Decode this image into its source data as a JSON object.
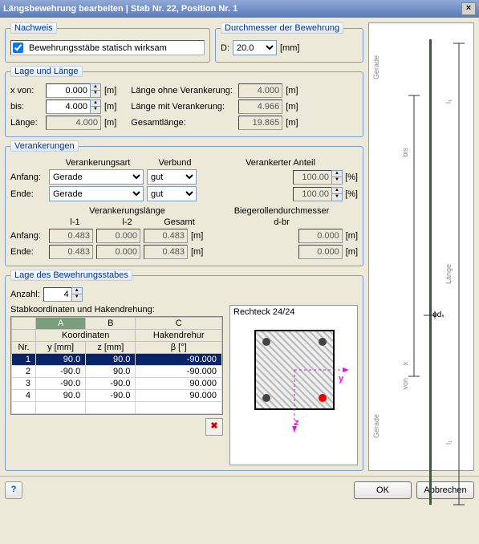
{
  "title": "Längsbewehrung bearbeiten  |  Stab Nr. 22, Position Nr. 1",
  "nachweis": {
    "legend": "Nachweis",
    "checkbox": "Bewehrungsstäbe statisch wirksam"
  },
  "diameter": {
    "legend": "Durchmesser der Bewehrung",
    "d_label": "D:",
    "d_value": "20.0",
    "d_unit": "[mm]"
  },
  "lage": {
    "legend": "Lage und Länge",
    "xvon": "x von:",
    "xvon_v": "0.000",
    "xvon_u": "[m]",
    "bis": "bis:",
    "bis_v": "4.000",
    "bis_u": "[m]",
    "laenge": "Länge:",
    "laenge_v": "4.000",
    "laenge_u": "[m]",
    "lov": "Länge ohne Verankerung:",
    "lov_v": "4.000",
    "lov_u": "[m]",
    "lmv": "Länge mit Verankerung:",
    "lmv_v": "4.966",
    "lmv_u": "[m]",
    "ges": "Gesamtlänge:",
    "ges_v": "19.865",
    "ges_u": "[m]"
  },
  "verank": {
    "legend": "Verankerungen",
    "h_art": "Verankerungsart",
    "h_verb": "Verbund",
    "h_ant": "Verankerter Anteil",
    "anfang": "Anfang:",
    "ende": "Ende:",
    "art1": "Gerade",
    "art2": "Gerade",
    "verb1": "gut",
    "verb2": "gut",
    "ant1": "100.00",
    "ant2": "100.00",
    "pct": "[%]",
    "h_vl": "Verankerungslänge",
    "h_l1": "l-1",
    "h_l2": "l-2",
    "h_ges": "Gesamt",
    "h_bd": "Biegerollendurchmesser",
    "h_dbr": "d-br",
    "a_l1": "0.483",
    "a_l2": "0.000",
    "a_g": "0.483",
    "a_db": "0.000",
    "e_l1": "0.483",
    "e_l2": "0.000",
    "e_g": "0.483",
    "e_db": "0.000",
    "m": "[m]"
  },
  "pos": {
    "legend": "Lage des Bewehrungsstabes",
    "anzahl": "Anzahl:",
    "anzahl_v": "4",
    "subt": "Stabkoordinaten und Hakendrehung:",
    "cA": "A",
    "cB": "B",
    "cC": "C",
    "koord": "Koordinaten",
    "haken": "Hakendrehur",
    "nr": "Nr.",
    "y": "y [mm]",
    "z": "z [mm]",
    "beta": "β [°]",
    "rows": [
      [
        "1",
        "90.0",
        "90.0",
        "-90.000"
      ],
      [
        "2",
        "-90.0",
        "90.0",
        "-90.000"
      ],
      [
        "3",
        "-90.0",
        "-90.0",
        "90.000"
      ],
      [
        "4",
        "90.0",
        "-90.0",
        "90.000"
      ]
    ]
  },
  "section": {
    "title": "Rechteck 24/24"
  },
  "right": {
    "gerade1": "Gerade",
    "gerade2": "Gerade",
    "bis": "bis",
    "laenge": "Länge",
    "von": "von",
    "x": "x",
    "l1": "l₁",
    "l2": "l₁",
    "phids": "ɸdₛ"
  },
  "footer": {
    "ok": "OK",
    "cancel": "Abbrechen"
  }
}
